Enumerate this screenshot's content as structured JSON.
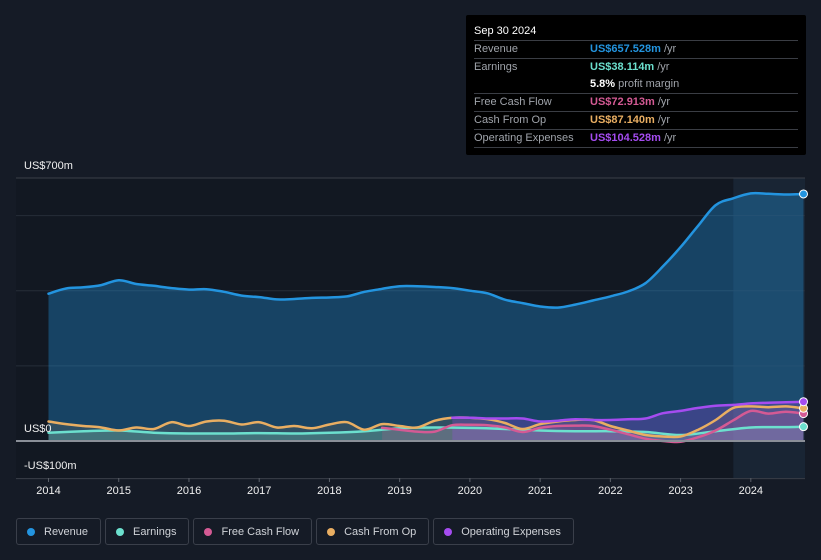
{
  "tooltip": {
    "date": "Sep 30 2024",
    "rows": [
      {
        "label": "Revenue",
        "value": "US$657.528m",
        "unit": "/yr",
        "color": "#2394df"
      },
      {
        "label": "Earnings",
        "value": "US$38.114m",
        "unit": "/yr",
        "color": "#6ce0ce"
      },
      {
        "label": "",
        "value": "5.8%",
        "unit": "profit margin",
        "color": "#ffffff"
      },
      {
        "label": "Free Cash Flow",
        "value": "US$72.913m",
        "unit": "/yr",
        "color": "#d45a94"
      },
      {
        "label": "Cash From Op",
        "value": "US$87.140m",
        "unit": "/yr",
        "color": "#e9ae62"
      },
      {
        "label": "Operating Expenses",
        "value": "US$104.528m",
        "unit": "/yr",
        "color": "#a54cf0"
      }
    ]
  },
  "legend": [
    {
      "label": "Revenue",
      "color": "#2394df"
    },
    {
      "label": "Earnings",
      "color": "#6ce0ce"
    },
    {
      "label": "Free Cash Flow",
      "color": "#d45a94"
    },
    {
      "label": "Cash From Op",
      "color": "#e9ae62"
    },
    {
      "label": "Operating Expenses",
      "color": "#a54cf0"
    }
  ],
  "chart_data": {
    "type": "line",
    "title": "",
    "xlabel": "",
    "ylabel": "",
    "y_tick_labels": [
      "US$700m",
      "US$0",
      "-US$100m"
    ],
    "ylim": [
      -100,
      700
    ],
    "x_tick_labels": [
      "2014",
      "2015",
      "2016",
      "2017",
      "2018",
      "2019",
      "2020",
      "2021",
      "2022",
      "2023",
      "2024"
    ],
    "xlim": [
      2014.0,
      2024.75
    ],
    "grid": true,
    "legend_position": "bottom",
    "highlight_period": [
      2023.75,
      2024.75
    ],
    "series": [
      {
        "name": "Revenue",
        "color": "#2394df",
        "x": [
          2014.0,
          2014.25,
          2014.5,
          2014.75,
          2015.0,
          2015.25,
          2015.5,
          2015.75,
          2016.0,
          2016.25,
          2016.5,
          2016.75,
          2017.0,
          2017.25,
          2017.5,
          2017.75,
          2018.0,
          2018.25,
          2018.5,
          2018.75,
          2019.0,
          2019.25,
          2019.5,
          2019.75,
          2020.0,
          2020.25,
          2020.5,
          2020.75,
          2021.0,
          2021.25,
          2021.5,
          2021.75,
          2022.0,
          2022.25,
          2022.5,
          2022.75,
          2023.0,
          2023.25,
          2023.5,
          2023.75,
          2024.0,
          2024.25,
          2024.5,
          2024.75
        ],
        "values": [
          392,
          406,
          409,
          415,
          428,
          418,
          413,
          407,
          403,
          404,
          397,
          387,
          383,
          377,
          378,
          381,
          382,
          385,
          397,
          405,
          412,
          412,
          410,
          407,
          400,
          393,
          376,
          367,
          358,
          355,
          363,
          374,
          385,
          398,
          420,
          465,
          516,
          573,
          628,
          646,
          659,
          658,
          656,
          657.528
        ]
      },
      {
        "name": "Earnings",
        "color": "#6ce0ce",
        "x": [
          2014.0,
          2014.5,
          2015.0,
          2015.5,
          2016.0,
          2016.5,
          2017.0,
          2017.5,
          2018.0,
          2018.5,
          2019.0,
          2019.5,
          2020.0,
          2020.5,
          2021.0,
          2021.5,
          2022.0,
          2022.5,
          2023.0,
          2023.5,
          2024.0,
          2024.5,
          2024.75
        ],
        "values": [
          22,
          26,
          28,
          22,
          20,
          20,
          21,
          20,
          22,
          26,
          34,
          36,
          35,
          32,
          28,
          26,
          26,
          24,
          16,
          26,
          36,
          37,
          38.114
        ]
      },
      {
        "name": "Free Cash Flow",
        "color": "#d45a94",
        "x": [
          2018.75,
          2019.0,
          2019.25,
          2019.5,
          2019.75,
          2020.0,
          2020.25,
          2020.5,
          2020.75,
          2021.0,
          2021.25,
          2021.5,
          2021.75,
          2022.0,
          2022.25,
          2022.5,
          2022.75,
          2023.0,
          2023.25,
          2023.5,
          2023.75,
          2024.0,
          2024.25,
          2024.5,
          2024.75
        ],
        "values": [
          35,
          30,
          25,
          25,
          42,
          43,
          42,
          36,
          24,
          35,
          40,
          41,
          40,
          30,
          18,
          6,
          0,
          -2,
          10,
          28,
          55,
          80,
          73,
          78,
          72.913
        ]
      },
      {
        "name": "Cash From Op",
        "color": "#e9ae62",
        "x": [
          2014.0,
          2014.25,
          2014.5,
          2014.75,
          2015.0,
          2015.25,
          2015.5,
          2015.75,
          2016.0,
          2016.25,
          2016.5,
          2016.75,
          2017.0,
          2017.25,
          2017.5,
          2017.75,
          2018.0,
          2018.25,
          2018.5,
          2018.75,
          2019.0,
          2019.25,
          2019.5,
          2019.75,
          2020.0,
          2020.25,
          2020.5,
          2020.75,
          2021.0,
          2021.25,
          2021.5,
          2021.75,
          2022.0,
          2022.25,
          2022.5,
          2022.75,
          2023.0,
          2023.25,
          2023.5,
          2023.75,
          2024.0,
          2024.25,
          2024.5,
          2024.75
        ],
        "values": [
          52,
          45,
          40,
          36,
          28,
          36,
          32,
          50,
          40,
          52,
          54,
          44,
          50,
          36,
          40,
          34,
          44,
          50,
          30,
          45,
          40,
          36,
          54,
          62,
          62,
          58,
          48,
          32,
          45,
          52,
          56,
          56,
          40,
          28,
          16,
          12,
          12,
          30,
          56,
          88,
          92,
          90,
          92,
          87.14
        ]
      },
      {
        "name": "Operating Expenses",
        "color": "#a54cf0",
        "x": [
          2019.75,
          2020.0,
          2020.25,
          2020.5,
          2020.75,
          2021.0,
          2021.25,
          2021.5,
          2021.75,
          2022.0,
          2022.25,
          2022.5,
          2022.75,
          2023.0,
          2023.25,
          2023.5,
          2023.75,
          2024.0,
          2024.25,
          2024.5,
          2024.75
        ],
        "values": [
          62,
          62,
          60,
          60,
          60,
          52,
          54,
          58,
          56,
          56,
          58,
          60,
          74,
          80,
          88,
          94,
          96,
          100,
          102,
          103,
          104.528
        ]
      }
    ]
  }
}
